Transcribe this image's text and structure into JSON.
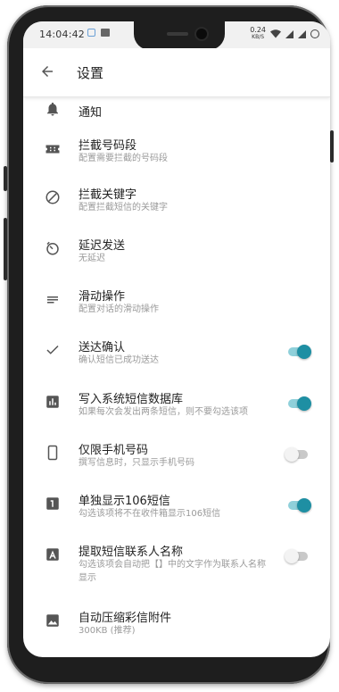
{
  "status_bar": {
    "time": "14:04:42",
    "speed_value": "0.24",
    "speed_unit": "KB/S"
  },
  "app_bar": {
    "title": "设置"
  },
  "settings": [
    {
      "icon": "bell-icon",
      "label": "通知",
      "sub": ""
    },
    {
      "icon": "ticket-icon",
      "label": "拦截号码段",
      "sub": "配置需要拦截的号码段"
    },
    {
      "icon": "block-icon",
      "label": "拦截关键字",
      "sub": "配置拦截短信的关键字"
    },
    {
      "icon": "timer-icon",
      "label": "延迟发送",
      "sub": "无延迟"
    },
    {
      "icon": "short-text-icon",
      "label": "滑动操作",
      "sub": "配置对话的滑动操作"
    },
    {
      "icon": "check-icon",
      "label": "送达确认",
      "sub": "确认短信已成功送达",
      "toggle": true
    },
    {
      "icon": "bar-chart-icon",
      "label": "写入系统短信数据库",
      "sub": "如果每次会发出两条短信，则不要勾选该项",
      "toggle": true
    },
    {
      "icon": "phone-icon",
      "label": "仅限手机号码",
      "sub": "撰写信息时，只显示手机号码",
      "toggle": false
    },
    {
      "icon": "number-one-icon",
      "label": "单独显示106短信",
      "sub": "勾选该项将不在收件箱显示106短信",
      "toggle": true
    },
    {
      "icon": "letter-a-icon",
      "label": "提取短信联系人名称",
      "sub": "勾选该项会自动把【】中的文字作为联系人名称显示",
      "toggle": false
    },
    {
      "icon": "image-icon",
      "label": "自动压缩彩信附件",
      "sub": "300KB (推荐)"
    }
  ]
}
